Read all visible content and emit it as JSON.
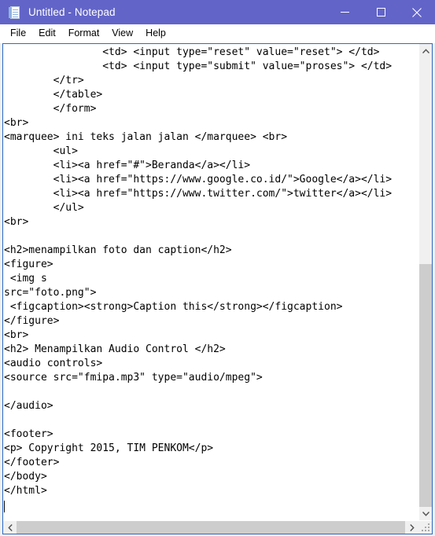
{
  "window": {
    "title": "Untitled - Notepad",
    "icon": "notepad-icon",
    "titlebar_color": "#6264c8",
    "controls": {
      "minimize": "minimize-icon",
      "maximize": "maximize-icon",
      "close": "close-icon"
    }
  },
  "menu": {
    "items": [
      {
        "label": "File"
      },
      {
        "label": "Edit"
      },
      {
        "label": "Format"
      },
      {
        "label": "View"
      },
      {
        "label": "Help"
      }
    ]
  },
  "editor": {
    "focus_border_color": "#2d6ac4",
    "font_size_px": 13,
    "line_height_px": 18,
    "caret_visible": true,
    "text": "                <td> <input type=\"reset\" value=\"reset\"> </td>\n                <td> <input type=\"submit\" value=\"proses\"> </td>\n        </tr>\n        </table>\n        </form>\n<br>\n<marquee> ini teks jalan jalan </marquee> <br>\n        <ul>\n        <li><a href=\"#\">Beranda</a></li>\n        <li><a href=\"https://www.google.co.id/\">Google</a></li>\n        <li><a href=\"https://www.twitter.com/\">twitter</a></li>\n        </ul>\n<br>\n\n<h2>menampilkan foto dan caption</h2>\n<figure>\n <img s\nsrc=\"foto.png\">\n <figcaption><strong>Caption this</strong></figcaption>\n</figure>\n<br>\n<h2> Menampilkan Audio Control </h2>\n<audio controls>\n<source src=\"fmipa.mp3\" type=\"audio/mpeg\">\n\n</audio>\n\n<footer>\n<p> Copyright 2015, TIM PENKOM</p>\n</footer>\n</body>\n</html>\n"
  },
  "scrollbars": {
    "vertical": {
      "up_arrow": "chevron-up-icon",
      "down_arrow": "chevron-down-icon",
      "thumb_top_pct": 46,
      "thumb_height_pct": 54
    },
    "horizontal": {
      "left_arrow": "chevron-left-icon",
      "right_arrow": "chevron-right-icon",
      "thumb_left_pct": 0,
      "thumb_width_pct": 100
    },
    "resize_grip": "resize-grip-icon"
  }
}
